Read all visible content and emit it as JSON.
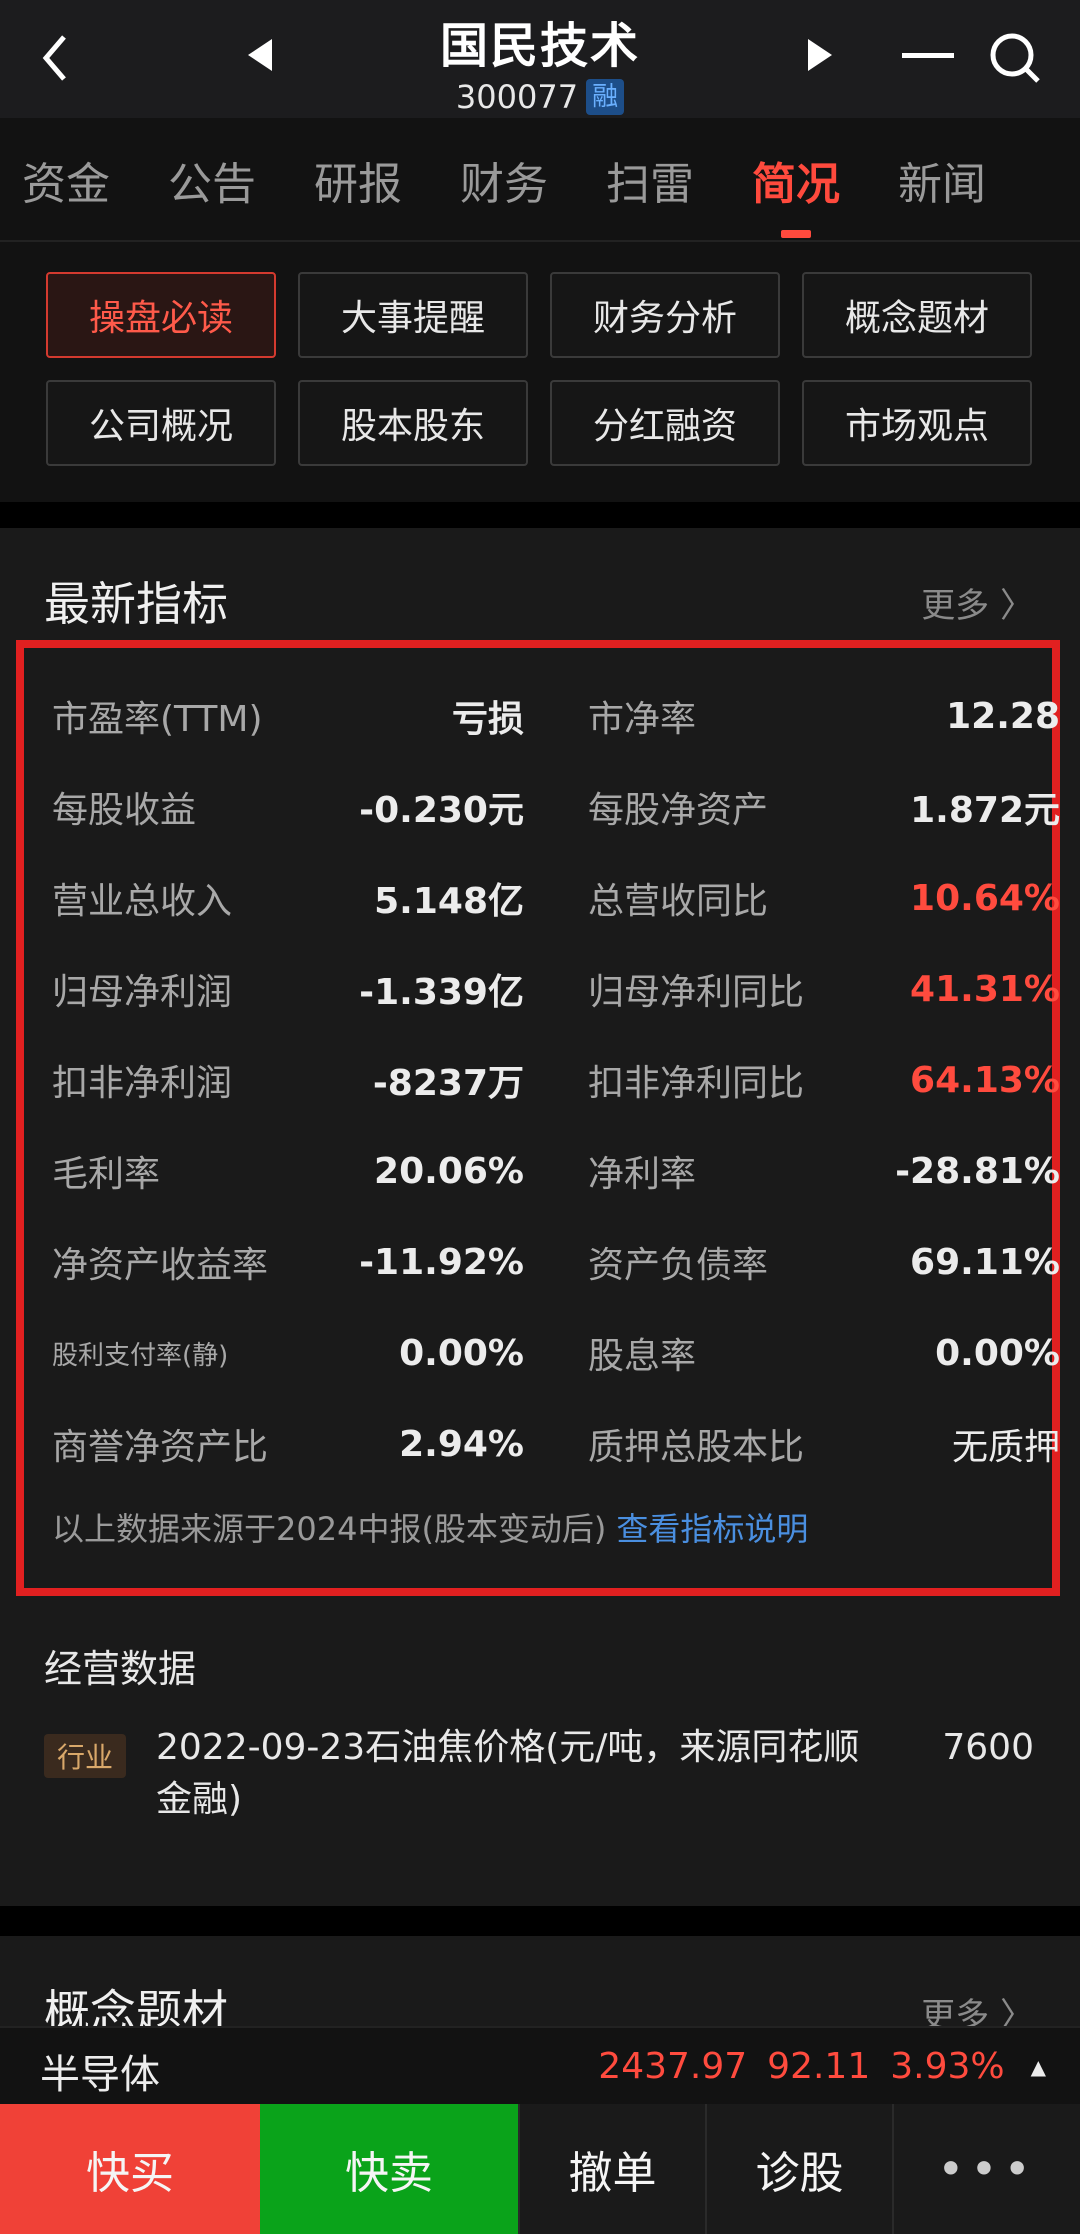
{
  "header": {
    "stock_name": "国民技术",
    "stock_code": "300077",
    "badge": "融"
  },
  "tabs": [
    {
      "label": "资金"
    },
    {
      "label": "公告"
    },
    {
      "label": "研报"
    },
    {
      "label": "财务"
    },
    {
      "label": "扫雷"
    },
    {
      "label": "简况",
      "active": true
    },
    {
      "label": "新闻"
    }
  ],
  "sub_buttons": [
    {
      "label": "操盘必读",
      "active": true
    },
    {
      "label": "大事提醒"
    },
    {
      "label": "财务分析"
    },
    {
      "label": "概念题材"
    },
    {
      "label": "公司概况"
    },
    {
      "label": "股本股东"
    },
    {
      "label": "分红融资"
    },
    {
      "label": "市场观点"
    }
  ],
  "latest": {
    "title": "最新指标",
    "more": "更多 〉",
    "rows": [
      {
        "l1": "市盈率(TTM)",
        "v1": "亏损",
        "l2": "市净率",
        "v2": "12.28"
      },
      {
        "l1": "每股收益",
        "v1": "-0.230元",
        "l2": "每股净资产",
        "v2": "1.872元"
      },
      {
        "l1": "营业总收入",
        "v1": "5.148亿",
        "l2": "总营收同比",
        "v2": "10.64%"
      },
      {
        "l1": "归母净利润",
        "v1": "-1.339亿",
        "l2": "归母净利同比",
        "v2": "41.31%"
      },
      {
        "l1": "扣非净利润",
        "v1": "-8237万",
        "l2": "扣非净利同比",
        "v2": "64.13%"
      },
      {
        "l1": "毛利率",
        "v1": "20.06%",
        "l2": "净利率",
        "v2": "-28.81%"
      },
      {
        "l1": "净资产收益率",
        "v1": "-11.92%",
        "l2": "资产负债率",
        "v2": "69.11%"
      },
      {
        "l1": "股利支付率(静)",
        "v1": "0.00%",
        "l2": "股息率",
        "v2": "0.00%"
      },
      {
        "l1": "商誉净资产比",
        "v1": "2.94%",
        "l2": "质押总股本比",
        "v2": "无质押"
      }
    ],
    "source_text": "以上数据来源于2024中报(股本变动后)",
    "source_link": "查看指标说明",
    "highlight_color": "#ff4b3e"
  },
  "ops": {
    "title": "经营数据",
    "badge": "行业",
    "text": "2022-09-23石油焦价格(元/吨，来源同花顺金融)",
    "value": "7600"
  },
  "concept": {
    "title": "概念题材",
    "more": "更多 〉"
  },
  "ticker": {
    "name": "半导体",
    "price": "2437.97",
    "change": "92.11",
    "pct": "3.93%"
  },
  "bottom": {
    "buy": "快买",
    "sell": "快卖",
    "cancel": "撤单",
    "diagnose": "诊股",
    "more": "•••"
  }
}
